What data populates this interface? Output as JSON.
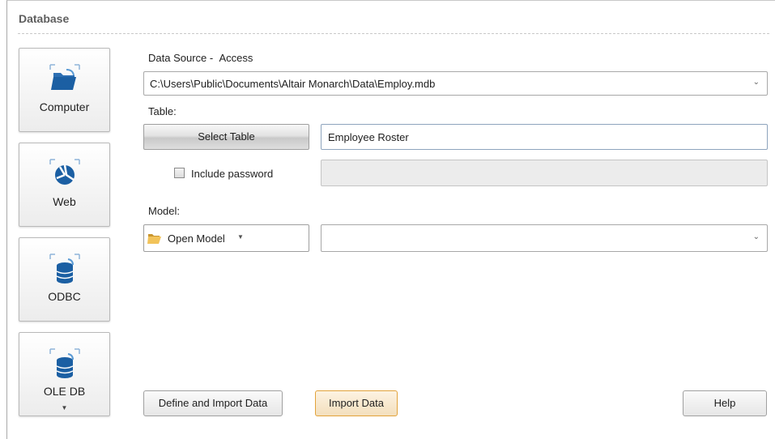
{
  "panel": {
    "title": "Database"
  },
  "sources": [
    {
      "label": "Computer",
      "icon": "folder-icon"
    },
    {
      "label": "Web",
      "icon": "globe-icon"
    },
    {
      "label": "ODBC",
      "icon": "database-icon"
    },
    {
      "label": "OLE DB",
      "icon": "database-icon",
      "has_dropdown": true
    }
  ],
  "data_source": {
    "label": "Data Source -",
    "type": "Access",
    "path": "C:\\Users\\Public\\Documents\\Altair Monarch\\Data\\Employ.mdb"
  },
  "table": {
    "label": "Table:",
    "select_button": "Select Table",
    "value": "Employee Roster"
  },
  "password": {
    "checkbox_label": "Include password",
    "checked": false,
    "value": ""
  },
  "model": {
    "label": "Model:",
    "open_button": "Open Model",
    "value": ""
  },
  "footer": {
    "define_import": "Define and Import Data",
    "import": "Import Data",
    "help": "Help"
  },
  "colors": {
    "accent_border": "#e2a33b",
    "section_title": "#5f5f5f",
    "icon_blue": "#1b5fa3"
  }
}
